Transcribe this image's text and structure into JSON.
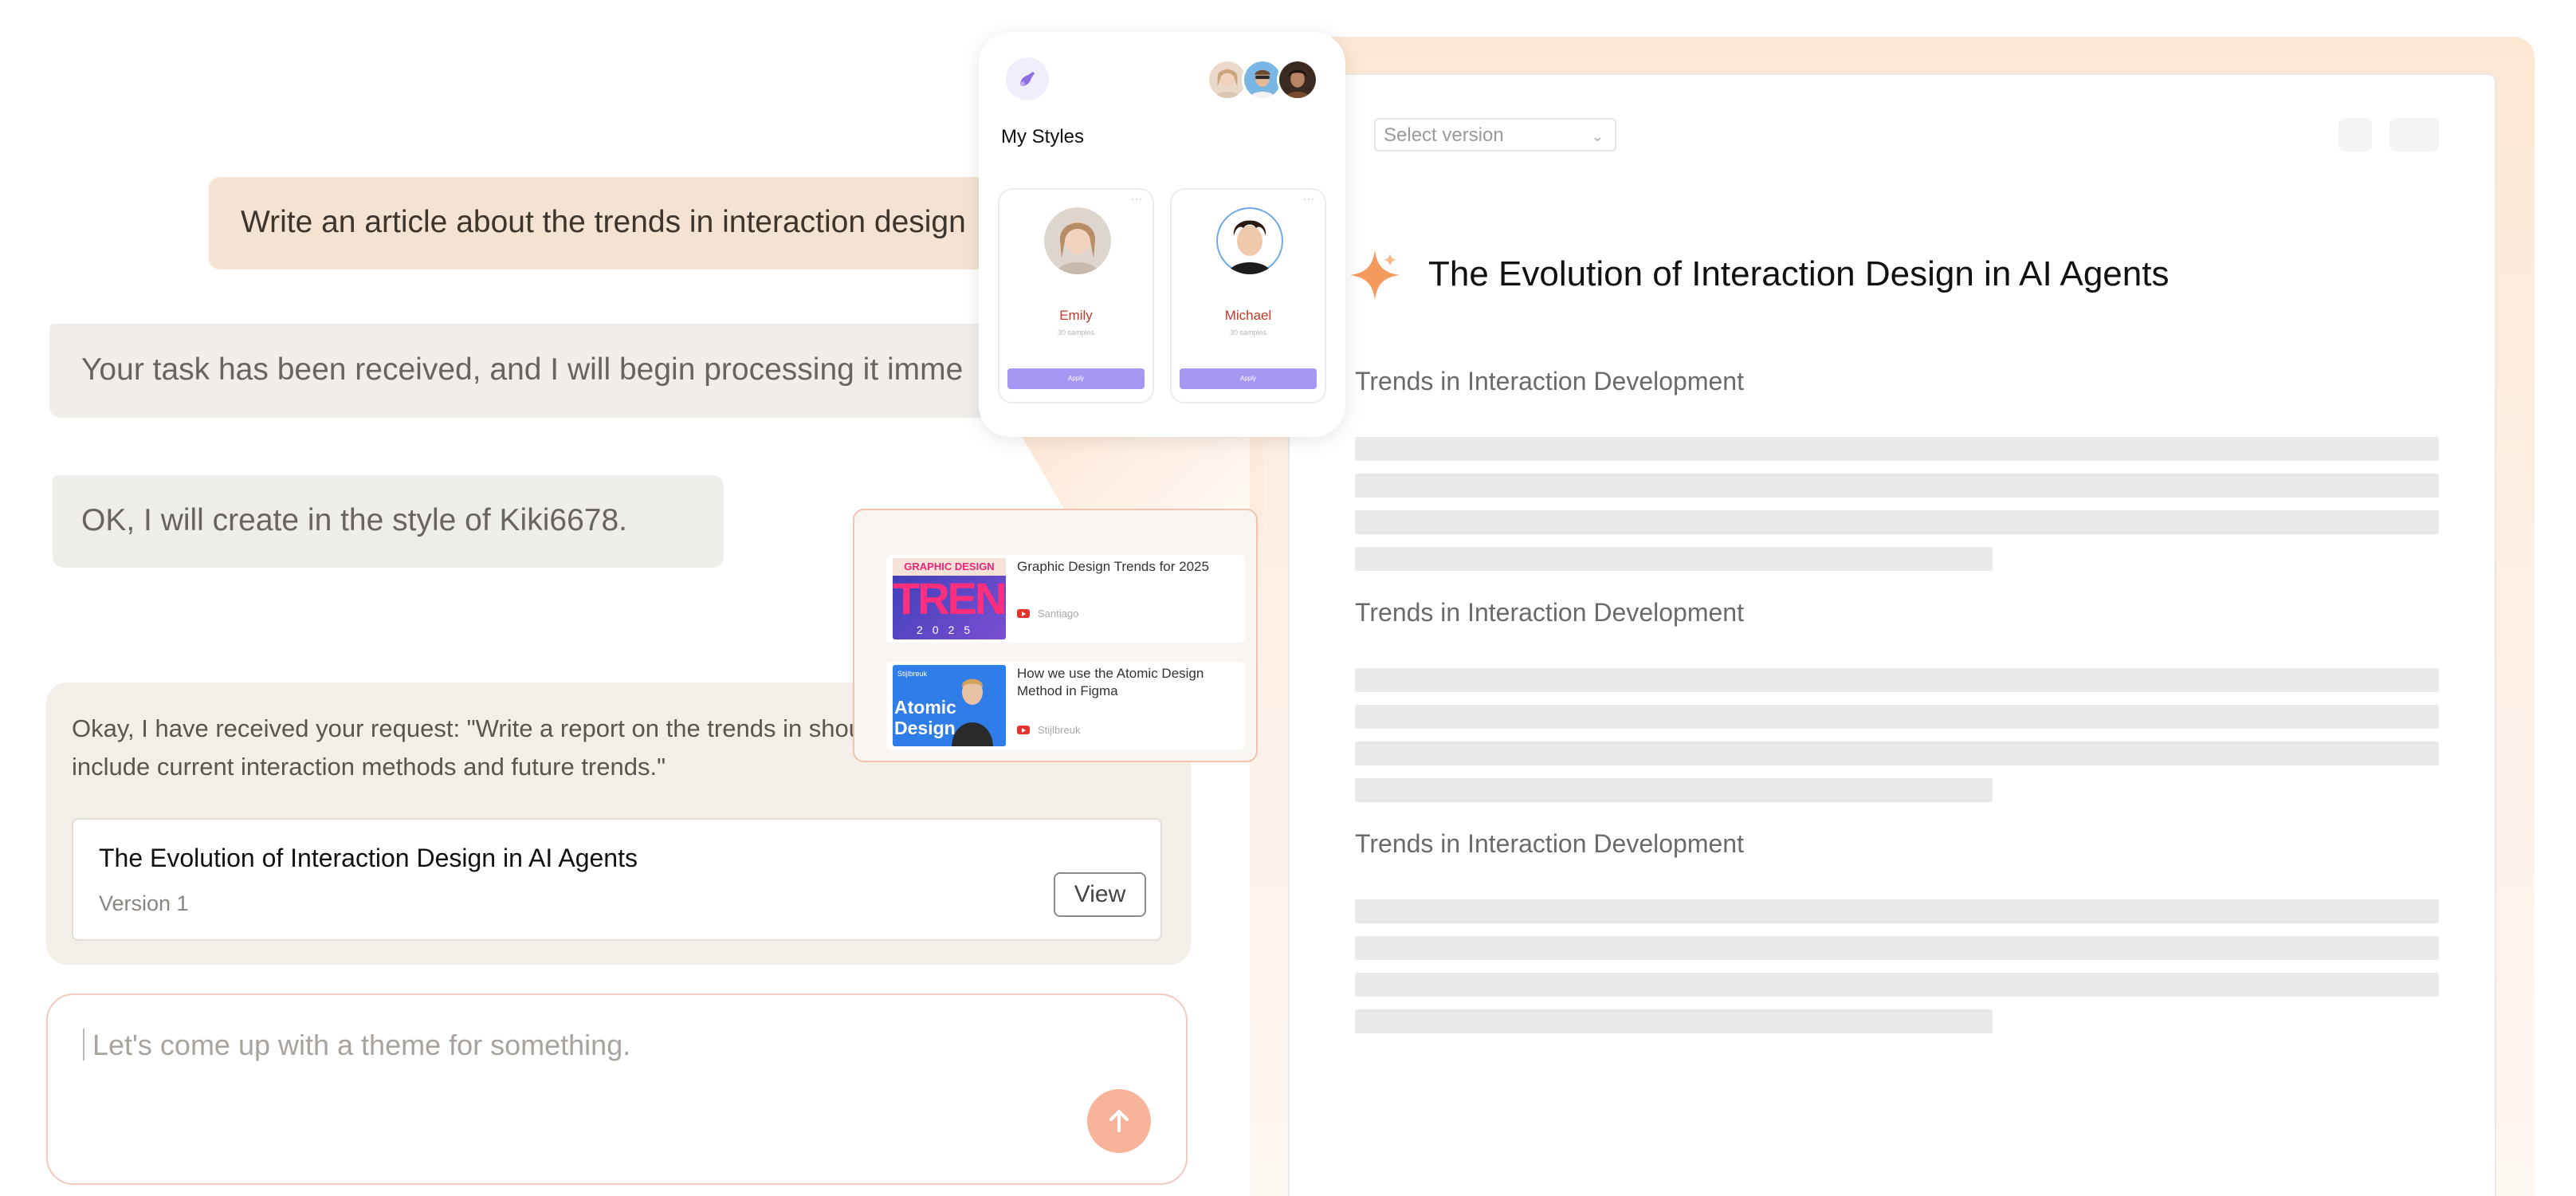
{
  "chat": {
    "user_message": "Write an article about the trends in interaction design",
    "ai_message_1": "Your task has been received, and I will begin processing it imme",
    "ai_message_2": "OK, I will create in the style of Kiki6678.",
    "response_text": "Okay, I have received your request: \"Write a report on the trends in should include current interaction methods and future trends.\"",
    "artifact": {
      "title": "The Evolution of Interaction Design in AI Agents",
      "version": "Version 1",
      "view_label": "View"
    },
    "input": {
      "placeholder": "Let's come up with a theme for something."
    }
  },
  "styles_popup": {
    "title": "My Styles",
    "profiles": [
      {
        "name": "Emily",
        "subtitle": "30 samples",
        "button": "Apply"
      },
      {
        "name": "Michael",
        "subtitle": "30 samples",
        "button": "Apply"
      }
    ]
  },
  "references": [
    {
      "title": "Graphic Design Trends for 2025",
      "source": "Santiago",
      "thumb_band": "GRAPHIC DESIGN",
      "thumb_big": "TRENDS",
      "thumb_year": "2025"
    },
    {
      "title": "How we use the Atomic Design Method in Figma",
      "source": "Stijlbreuk",
      "thumb_brand": "Stijlbreuk",
      "thumb_text_1": "Atomic",
      "thumb_text_2": "Design"
    }
  ],
  "document": {
    "version_select_placeholder": "Select version",
    "title": "The Evolution of Interaction Design in AI Agents",
    "sections": [
      {
        "heading": "Trends in Interaction Development"
      },
      {
        "heading": "Trends in Interaction Development"
      },
      {
        "heading": "Trends in Interaction Development"
      }
    ]
  },
  "colors": {
    "accent_orange": "#f39a5c",
    "send_button": "#f8b49b",
    "user_bubble": "#f4e3d2",
    "apply_button": "#a797f3",
    "profile_name": "#c0392b"
  },
  "icons": {
    "doc_title_icon": "sparkle-icon",
    "send_icon": "arrow-up-icon",
    "styles_logo": "brush-icon",
    "version_chevron": "chevron-down-icon",
    "source_icon": "youtube-icon"
  }
}
